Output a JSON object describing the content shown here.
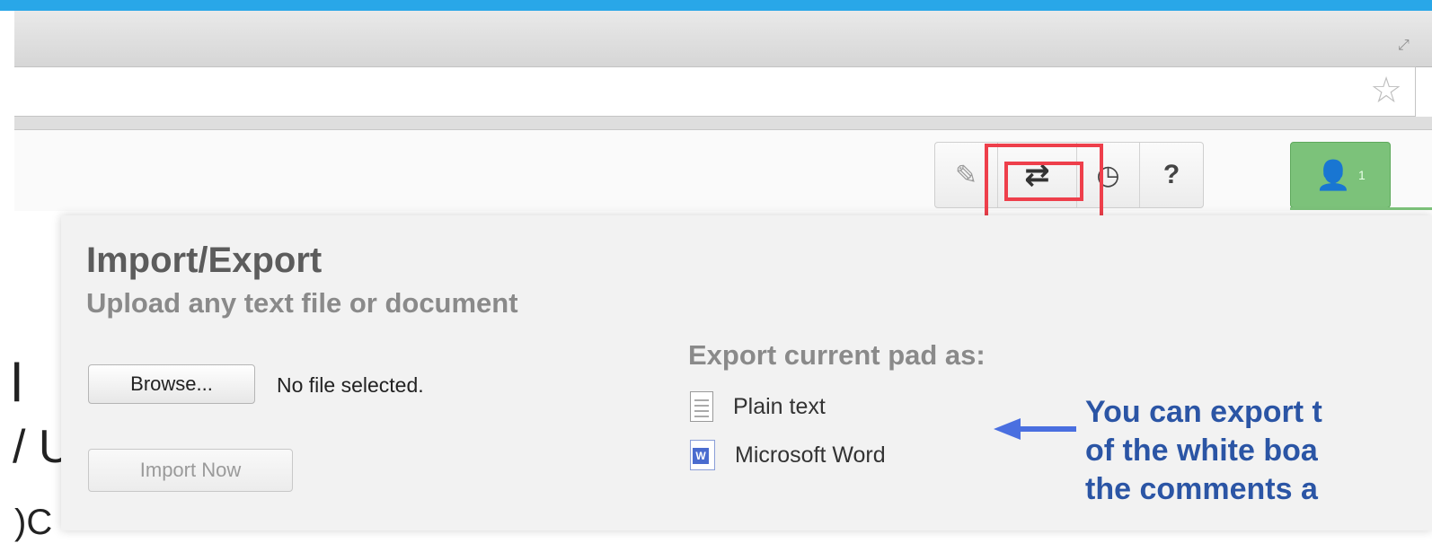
{
  "browser": {
    "resize_icon": "resize-icon",
    "star_icon": "star-icon"
  },
  "toolbar": {
    "buttons": [
      {
        "name": "pencil-icon",
        "glyph": "✎"
      },
      {
        "name": "import-export-icon",
        "glyph": "⇄"
      },
      {
        "name": "history-clock-icon",
        "glyph": "◷"
      },
      {
        "name": "help-icon",
        "glyph": "?"
      }
    ],
    "user_count": "1",
    "highlight_color": "#ee3f4b",
    "user_button_color": "#7cc27a"
  },
  "background_text": [
    "l",
    "/ U",
    ")C"
  ],
  "popup": {
    "title": "Import/Export",
    "subtitle": "Upload any text file or document",
    "browse_label": "Browse...",
    "file_status": "No file selected.",
    "import_label": "Import Now",
    "export_heading": "Export current pad as:",
    "export_options": [
      "Plain text",
      "Microsoft Word"
    ]
  },
  "annotation": {
    "lines": [
      "You can export t",
      "of the white boa",
      "the comments a"
    ],
    "color": "#2b55a5",
    "arrow_color": "#4a6fe0"
  }
}
